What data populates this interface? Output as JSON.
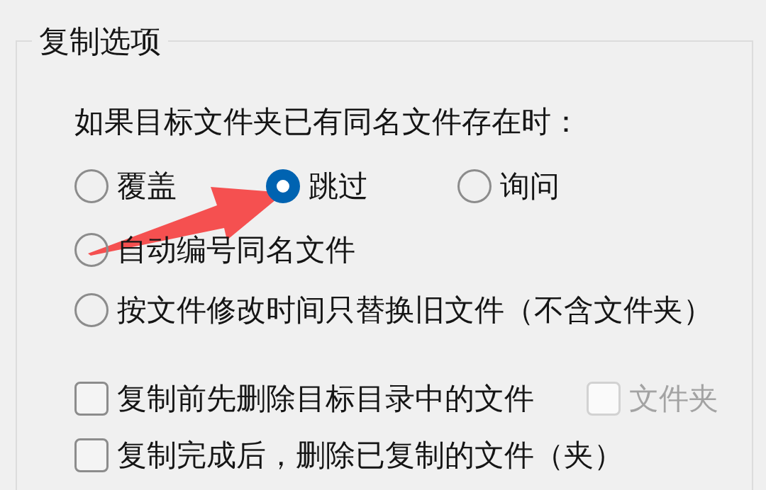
{
  "group": {
    "title": "复制选项"
  },
  "prompt": "如果目标文件夹已有同名文件存在时：",
  "radio_rows": [
    {
      "options": [
        {
          "label": "覆盖",
          "selected": false
        },
        {
          "label": "跳过",
          "selected": true
        },
        {
          "label": "询问",
          "selected": false
        }
      ]
    },
    {
      "options": [
        {
          "label": "自动编号同名文件",
          "selected": false
        }
      ]
    },
    {
      "options": [
        {
          "label": "按文件修改时间只替换旧文件（不含文件夹）",
          "selected": false
        }
      ]
    }
  ],
  "checkboxes": [
    {
      "label": "复制前先删除目标目录中的文件",
      "checked": false,
      "disabled": false,
      "sub_option": {
        "label": "文件夹",
        "checked": false,
        "disabled": true
      }
    },
    {
      "label": "复制完成后，删除已复制的文件（夹）",
      "checked": false,
      "disabled": false
    }
  ]
}
